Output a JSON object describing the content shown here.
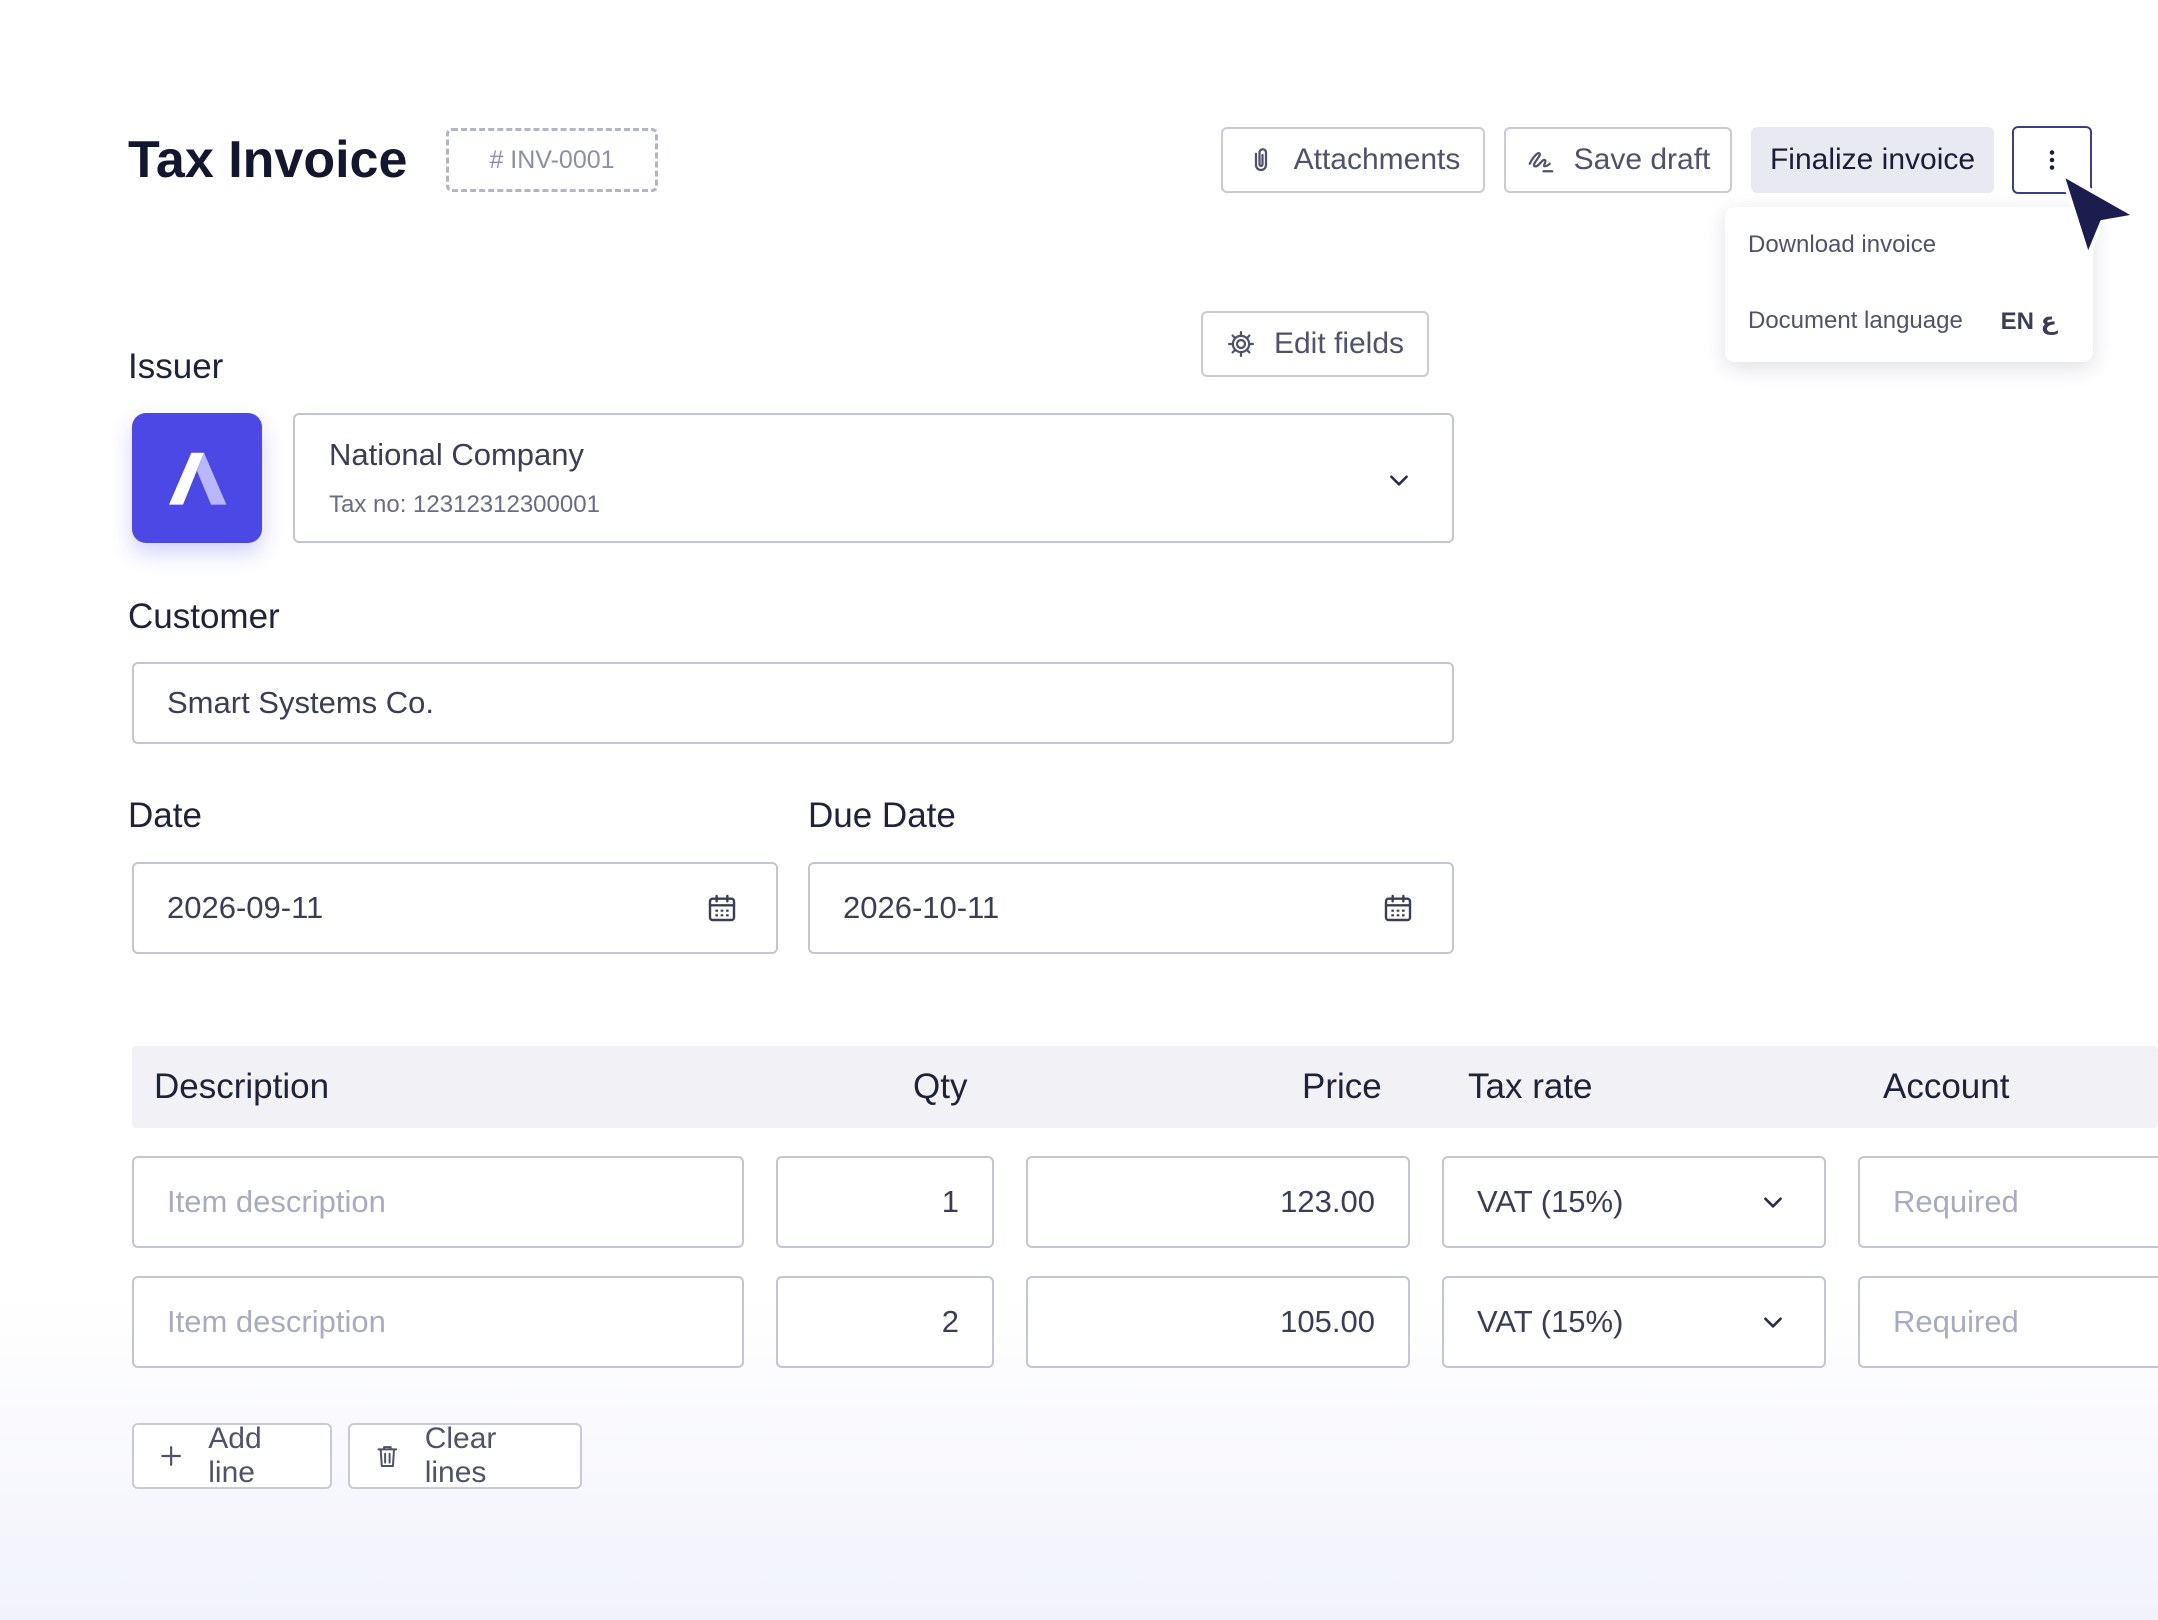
{
  "header": {
    "title": "Tax Invoice",
    "invoice_number": "# INV-0001",
    "attachments_label": "Attachments",
    "save_draft_label": "Save draft",
    "finalize_label": "Finalize invoice"
  },
  "more_menu": {
    "download_label": "Download invoice",
    "language_label": "Document language",
    "language_value": "EN ع"
  },
  "edit_fields_label": "Edit fields",
  "issuer": {
    "label": "Issuer",
    "company_name": "National Company",
    "tax_no": "Tax no: 12312312300001"
  },
  "customer": {
    "label": "Customer",
    "value": "Smart Systems Co."
  },
  "dates": {
    "date_label": "Date",
    "date_value": "2026-09-11",
    "due_label": "Due Date",
    "due_value": "2026-10-11"
  },
  "table": {
    "headers": {
      "description": "Description",
      "qty": "Qty",
      "price": "Price",
      "tax_rate": "Tax rate",
      "account": "Account"
    },
    "rows": [
      {
        "description_placeholder": "Item description",
        "qty": "1",
        "price": "123.00",
        "tax": "VAT (15%)",
        "account_placeholder": "Required"
      },
      {
        "description_placeholder": "Item description",
        "qty": "2",
        "price": "105.00",
        "tax": "VAT (15%)",
        "account_placeholder": "Required"
      }
    ]
  },
  "actions": {
    "add_line_label": "Add line",
    "clear_lines_label": "Clear lines"
  },
  "colors": {
    "brand": "#4b48e6",
    "cursor": "#1b1d4f"
  }
}
